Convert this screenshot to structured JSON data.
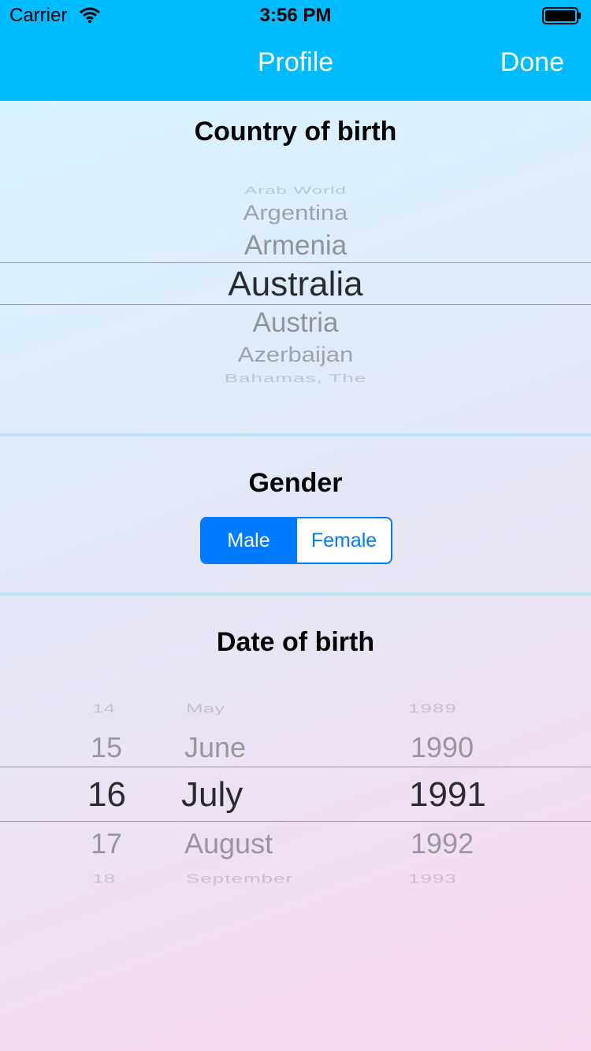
{
  "status_bar": {
    "carrier": "Carrier",
    "time": "3:56 PM"
  },
  "nav": {
    "title": "Profile",
    "done_label": "Done",
    "background_color": "#00bbff"
  },
  "country_section": {
    "title": "Country of birth",
    "options": [
      "Arab World",
      "Argentina",
      "Armenia",
      "Australia",
      "Austria",
      "Azerbaijan",
      "Bahamas, The"
    ],
    "selected": "Australia"
  },
  "gender_section": {
    "title": "Gender",
    "options": [
      "Male",
      "Female"
    ],
    "selected": "Male",
    "accent_color": "#007aff"
  },
  "dob_section": {
    "title": "Date of birth",
    "days": [
      "14",
      "15",
      "16",
      "17",
      "18"
    ],
    "months": [
      "May",
      "June",
      "July",
      "August",
      "September"
    ],
    "years": [
      "1989",
      "1990",
      "1991",
      "1992",
      "1993"
    ],
    "selected": {
      "day": "16",
      "month": "July",
      "year": "1991"
    }
  }
}
